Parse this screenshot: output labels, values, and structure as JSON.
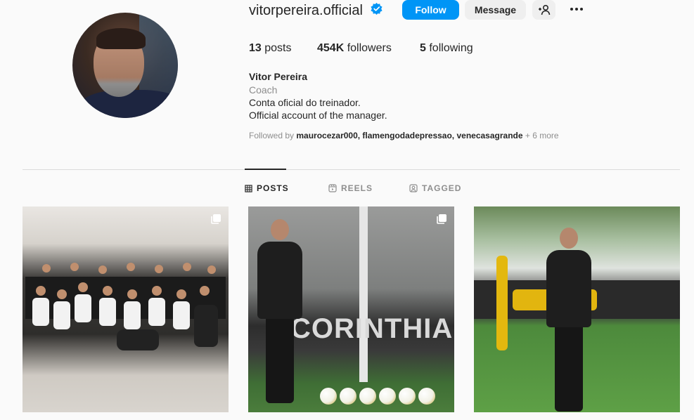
{
  "profile": {
    "username": "vitorpereira.official",
    "full_name": "Vitor Pereira",
    "category": "Coach",
    "bio_lines": [
      "Conta oficial do treinador.",
      "Official account of the manager."
    ],
    "followed_by_prefix": "Followed by",
    "followed_by_names": "maurocezar000, flamengodadepressao, venecasagrande",
    "followed_by_more": "+ 6 more"
  },
  "actions": {
    "follow_label": "Follow",
    "message_label": "Message"
  },
  "stats": {
    "posts_count": "13",
    "posts_label": "posts",
    "followers_count": "454K",
    "followers_label": "followers",
    "following_count": "5",
    "following_label": "following"
  },
  "tabs": [
    {
      "label": "POSTS",
      "active": true
    },
    {
      "label": "REELS",
      "active": false
    },
    {
      "label": "TAGGED",
      "active": false
    }
  ],
  "posts": [
    {
      "type": "carousel"
    },
    {
      "type": "carousel",
      "text": "CORINTHIAN"
    },
    {
      "type": "single"
    }
  ],
  "colors": {
    "primary_button": "#0095f6",
    "secondary_button": "#efefef",
    "verified_badge": "#0095f6",
    "muted_text": "#8e8e8e"
  }
}
